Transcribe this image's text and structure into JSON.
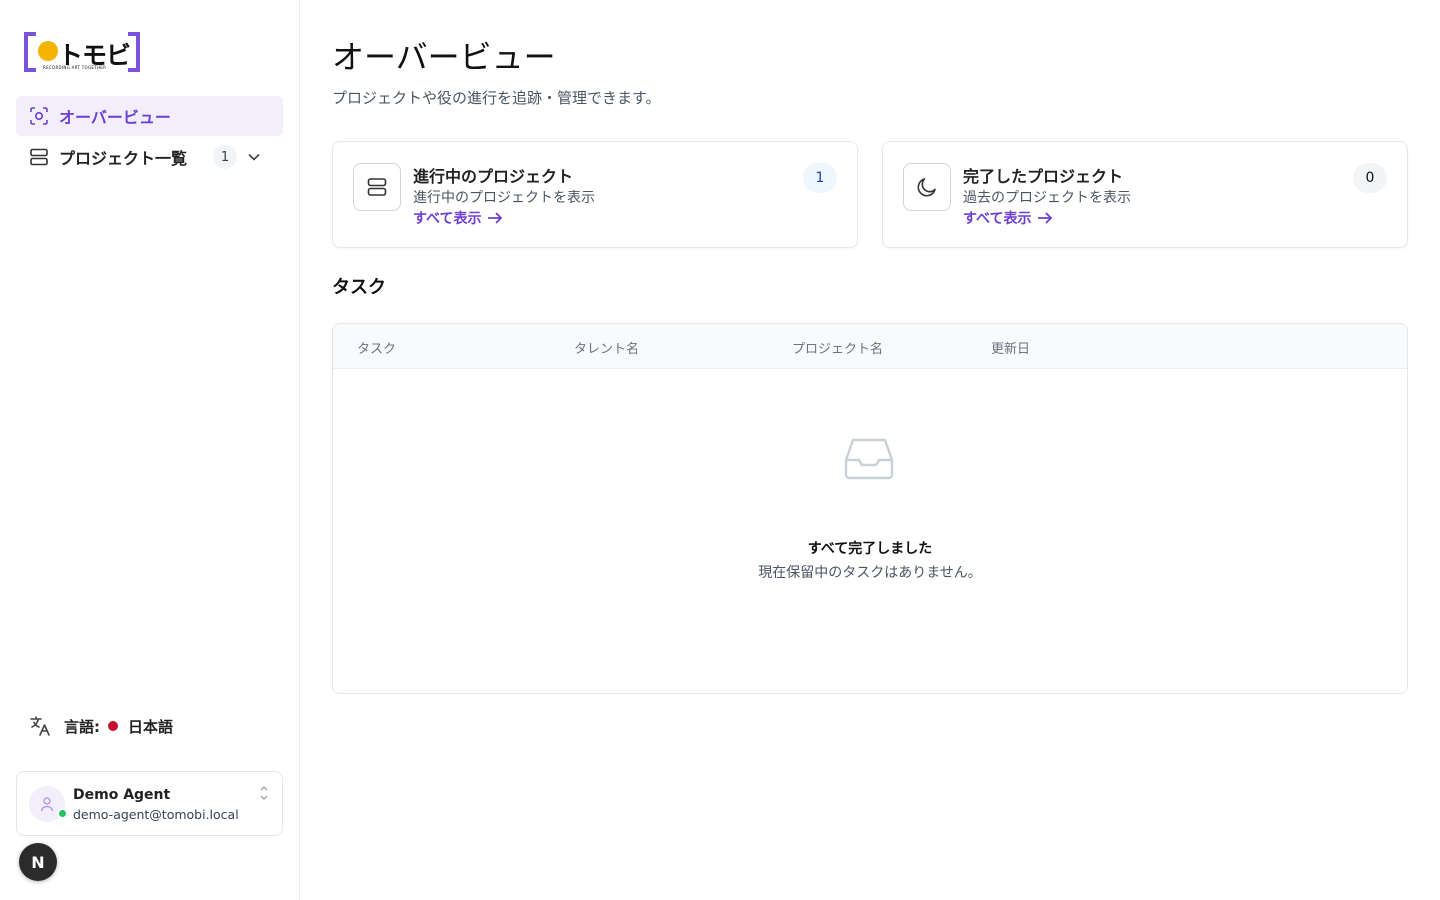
{
  "brand": {
    "name": "トモビ",
    "tagline": "RECORDING ART TOGETHER",
    "colors": {
      "bracket": "#7c52d9",
      "dot": "#f5b400"
    }
  },
  "sidebar": {
    "items": [
      {
        "label": "オーバービュー",
        "icon": "scan-icon",
        "active": true
      },
      {
        "label": "プロジェクト一覧",
        "icon": "server-stack-icon",
        "badge": "1",
        "expand_icon": "chevron-down-icon"
      }
    ],
    "language": {
      "label": "言語:",
      "value": "日本語",
      "icon": "translate-icon",
      "flag_color": "#c8102e"
    },
    "user": {
      "name": "Demo Agent",
      "email": "demo-agent@tomobi.local",
      "status": "online"
    },
    "dev_badge": "N"
  },
  "page": {
    "title": "オーバービュー",
    "subtitle": "プロジェクトや役の進行を追跡・管理できます。"
  },
  "cards": [
    {
      "title": "進行中のプロジェクト",
      "description": "進行中のプロジェクトを表示",
      "link": "すべて表示",
      "count": "1",
      "icon": "server-stack-icon"
    },
    {
      "title": "完了したプロジェクト",
      "description": "過去のプロジェクトを表示",
      "link": "すべて表示",
      "count": "0",
      "icon": "moon-icon"
    }
  ],
  "tasks": {
    "section_title": "タスク",
    "columns": [
      "タスク",
      "タレント名",
      "プロジェクト名",
      "更新日"
    ],
    "rows": [],
    "empty": {
      "title": "すべて完了しました",
      "subtitle": "現在保留中のタスクはありません。",
      "icon": "inbox-icon"
    }
  },
  "theme": {
    "accent": "#6d3fd0",
    "active_bg": "#f3eefc"
  }
}
